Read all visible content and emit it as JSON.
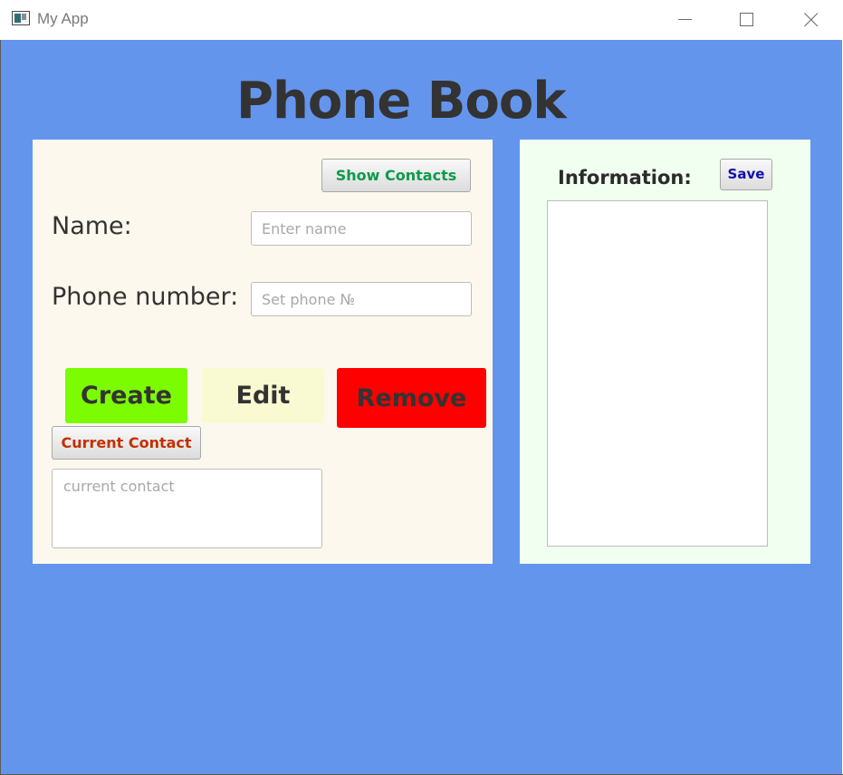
{
  "window": {
    "title": "My App",
    "icon": "app-window-icon",
    "controls": [
      "minimize-icon",
      "maximize-icon",
      "close-icon"
    ]
  },
  "page": {
    "title": "Phone Book",
    "background_color": "#6495ed"
  },
  "left_panel": {
    "background_color": "#fdf8ee",
    "show_contacts_label": "Show Contacts",
    "name_label": "Name:",
    "name_placeholder": "Enter name",
    "name_value": "",
    "phone_label": "Phone number:",
    "phone_placeholder": "Set phone №",
    "phone_value": "",
    "create_label": "Create",
    "create_color": "#7cfc00",
    "edit_label": "Edit",
    "edit_color": "#fafad2",
    "remove_label": "Remove",
    "remove_color": "#ff0000",
    "current_contact_label": "Current Contact",
    "current_contact_placeholder": "current contact",
    "current_contact_value": ""
  },
  "right_panel": {
    "background_color": "#f0fff0",
    "information_label": "Information:",
    "save_label": "Save",
    "information_value": ""
  }
}
